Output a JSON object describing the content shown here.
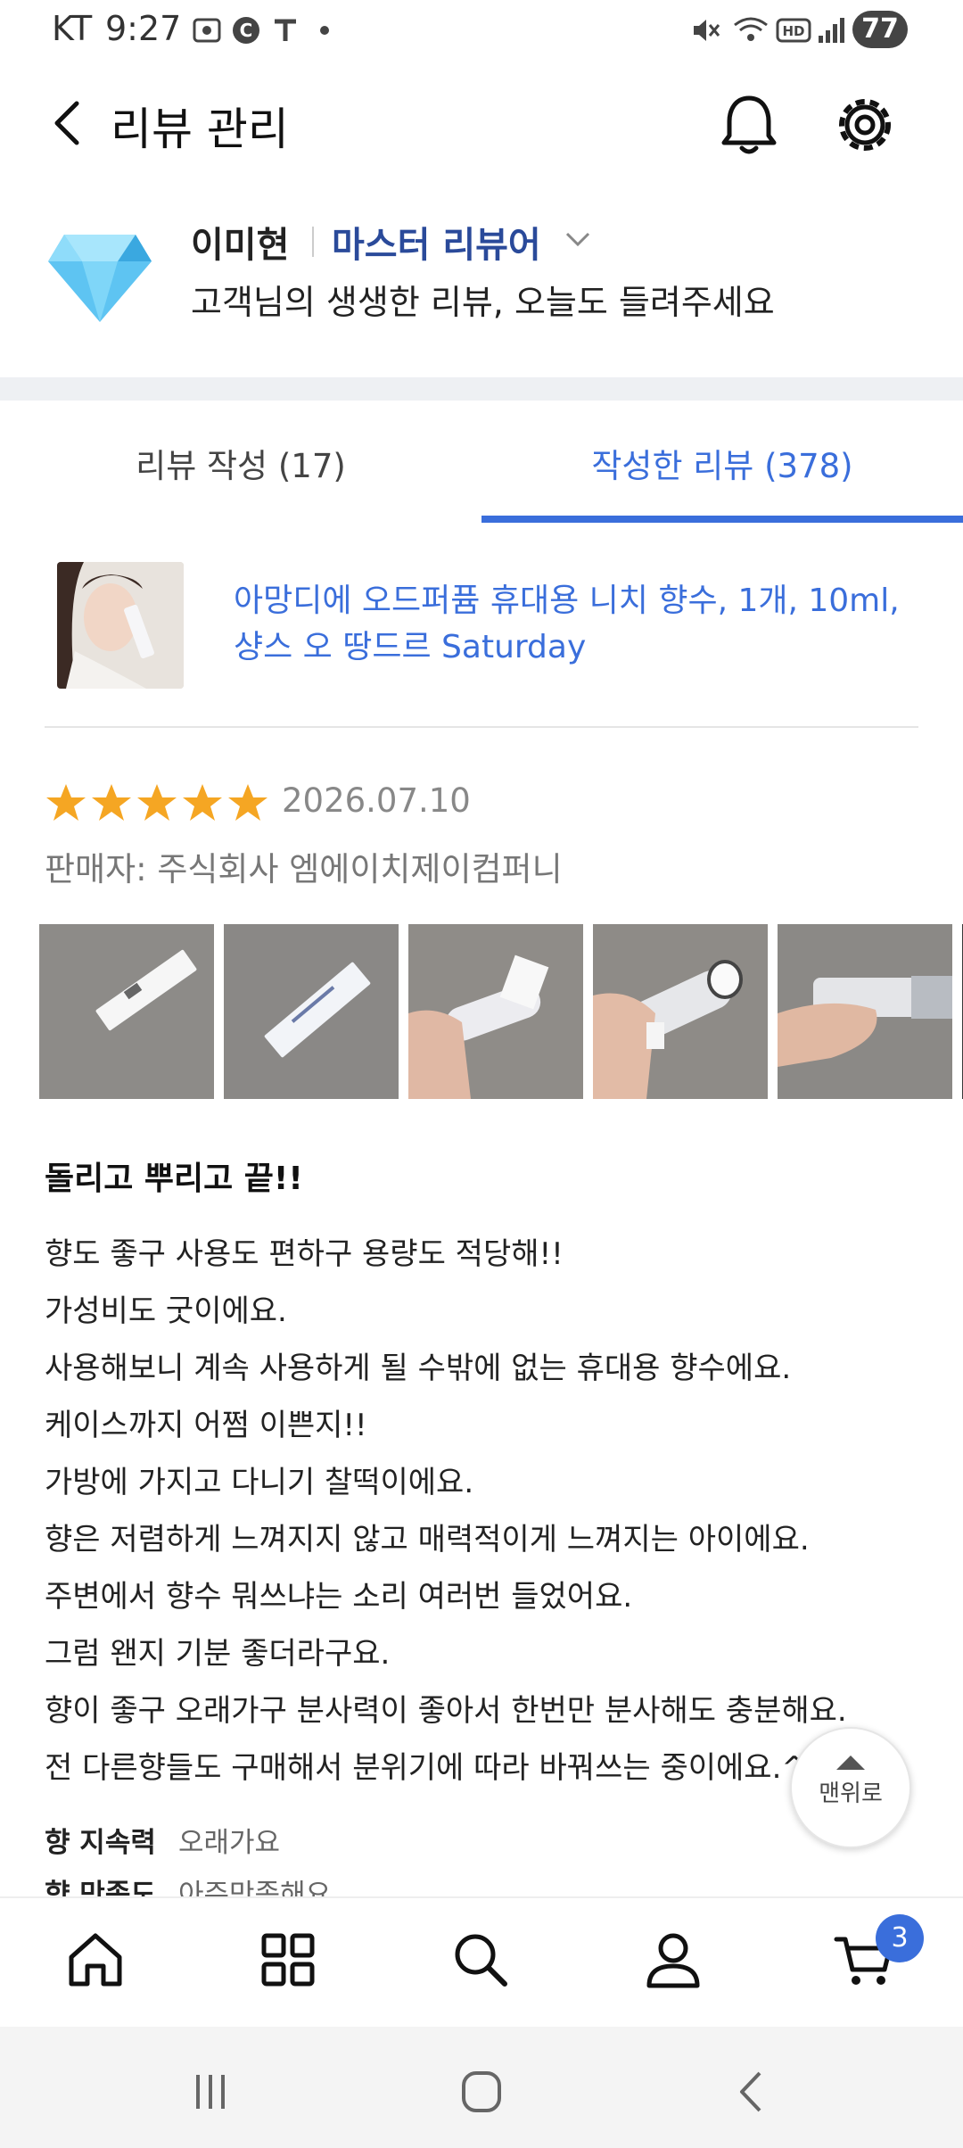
{
  "status_bar": {
    "carrier": "KT",
    "time": "9:27",
    "battery": "77"
  },
  "header": {
    "title": "리뷰 관리"
  },
  "profile": {
    "name": "이미현",
    "grade": "마스터 리뷰어",
    "greeting": "고객님의 생생한 리뷰, 오늘도 들려주세요"
  },
  "tabs": [
    {
      "label": "리뷰 작성 (17)"
    },
    {
      "label": "작성한 리뷰 (378)"
    }
  ],
  "review": {
    "product_name": "아망디에 오드퍼퓸 휴대용 니치 향수, 1개, 10ml, 샹스 오 땅드르 Saturday",
    "rating": 5,
    "date": "2026.07.10",
    "seller": "판매자: 주식회사 엠에이치제이컴퍼니",
    "title": "돌리고 뿌리고 끝!!",
    "lines": [
      "향도 좋구 사용도 편하구 용량도 적당해!!",
      "가성비도 굿이에요.",
      "사용해보니 계속 사용하게 될 수밖에 없는 휴대용 향수에요.",
      "케이스까지 어쩜 이쁜지!!",
      "가방에 가지고 다니기 찰떡이에요.",
      "향은 저렴하게 느껴지지 않고 매력적이게 느껴지는 아이에요.",
      "주변에서 향수 뭐쓰냐는 소리 여러번 들었어요.",
      "그럼 왠지 기분 좋더라구요.",
      "향이 좋구 오래가구 분사력이 좋아서 한번만 분사해도 충분해요.",
      "전 다른향들도 구매해서 분위기에 따라 바꿔쓰는 중이에요.^^"
    ],
    "attributes": [
      {
        "key": "향 지속력",
        "value": "오래가요"
      },
      {
        "key": "향 만족도",
        "value": "아주만족해요"
      }
    ]
  },
  "to_top_label": "맨위로",
  "bottom_nav": {
    "cart_badge": "3"
  },
  "colors": {
    "accent": "#3a6edb",
    "grade": "#2a4a9a",
    "star": "#f5a623"
  }
}
